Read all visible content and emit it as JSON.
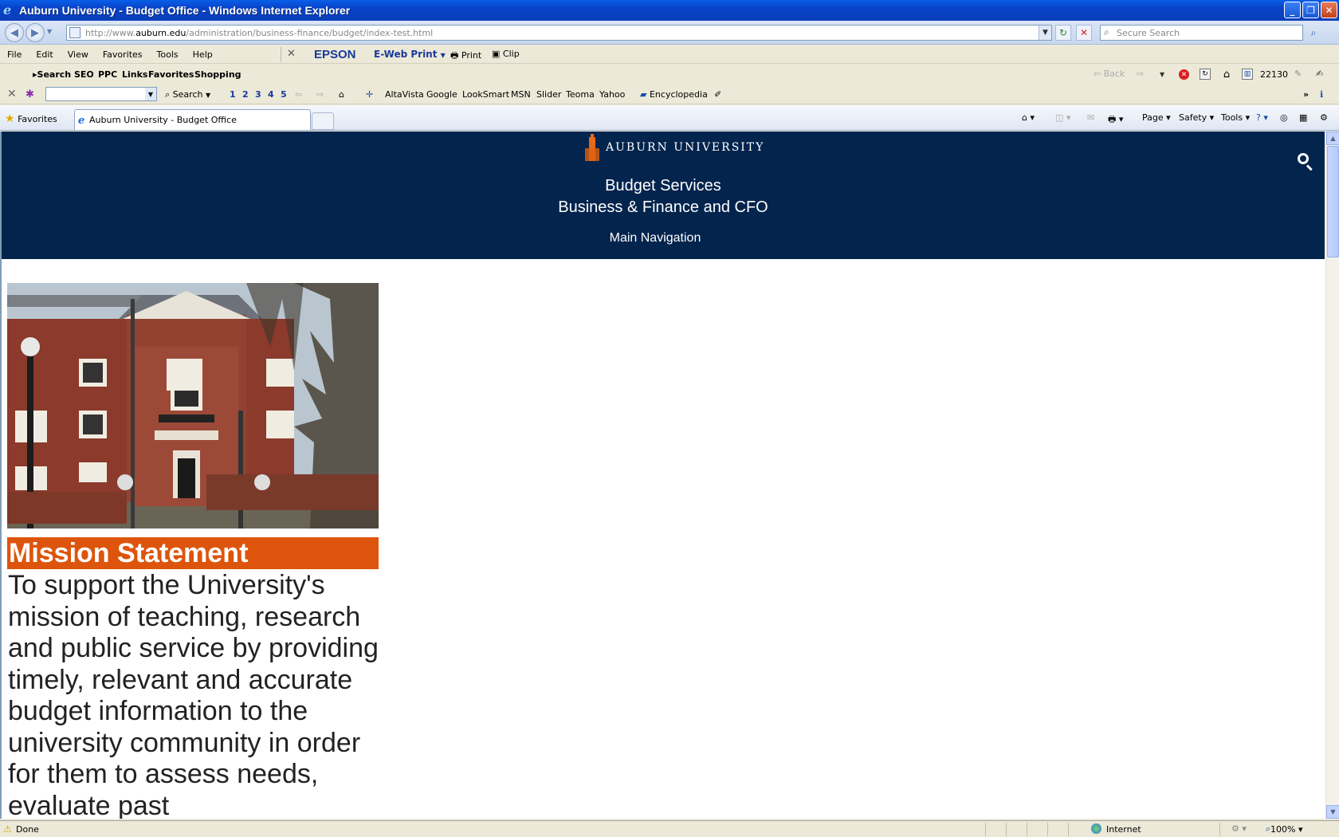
{
  "window": {
    "title": "Auburn University - Budget Office - Windows Internet Explorer"
  },
  "address": {
    "prefix": "http://www.",
    "domain": "auburn.edu",
    "path": "/administration/business-finance/budget/index-test.html",
    "search_placeholder": "Secure Search"
  },
  "menu": {
    "items": [
      "File",
      "Edit",
      "View",
      "Favorites",
      "Tools",
      "Help"
    ],
    "epson": "EPSON",
    "eweb_print": "E-Web Print",
    "print": "Print",
    "clip": "Clip"
  },
  "links_toolbar": {
    "items": [
      "Search",
      "SEO",
      "PPC",
      "Links",
      "Favorites",
      "Shopping"
    ],
    "back": "Back",
    "count": "22130"
  },
  "search_toolbar": {
    "search": "Search",
    "numbers": [
      "1",
      "2",
      "3",
      "4",
      "5"
    ],
    "engines": [
      "AltaVista",
      "Google",
      "LookSmart",
      "MSN",
      "Slider",
      "Teoma",
      "Yahoo"
    ],
    "encyclopedia": "Encyclopedia"
  },
  "tabs": {
    "favorites": "Favorites",
    "active_tab": "Auburn University - Budget Office",
    "page": "Page",
    "safety": "Safety",
    "tools": "Tools"
  },
  "site": {
    "brand": "AUBURN UNIVERSITY",
    "title": "Budget Services",
    "subtitle": "Business & Finance and CFO",
    "main_nav": "Main Navigation",
    "mission_heading": "Mission Statement",
    "mission_text": "To support the University's mission of teaching, research and public service by providing timely, relevant and accurate budget information to the university community in order for them to assess needs, evaluate past"
  },
  "status": {
    "done": "Done",
    "zone": "Internet",
    "zoom": "100%"
  },
  "colors": {
    "header_navy": "#03244d",
    "accent_orange": "#dd550c"
  }
}
